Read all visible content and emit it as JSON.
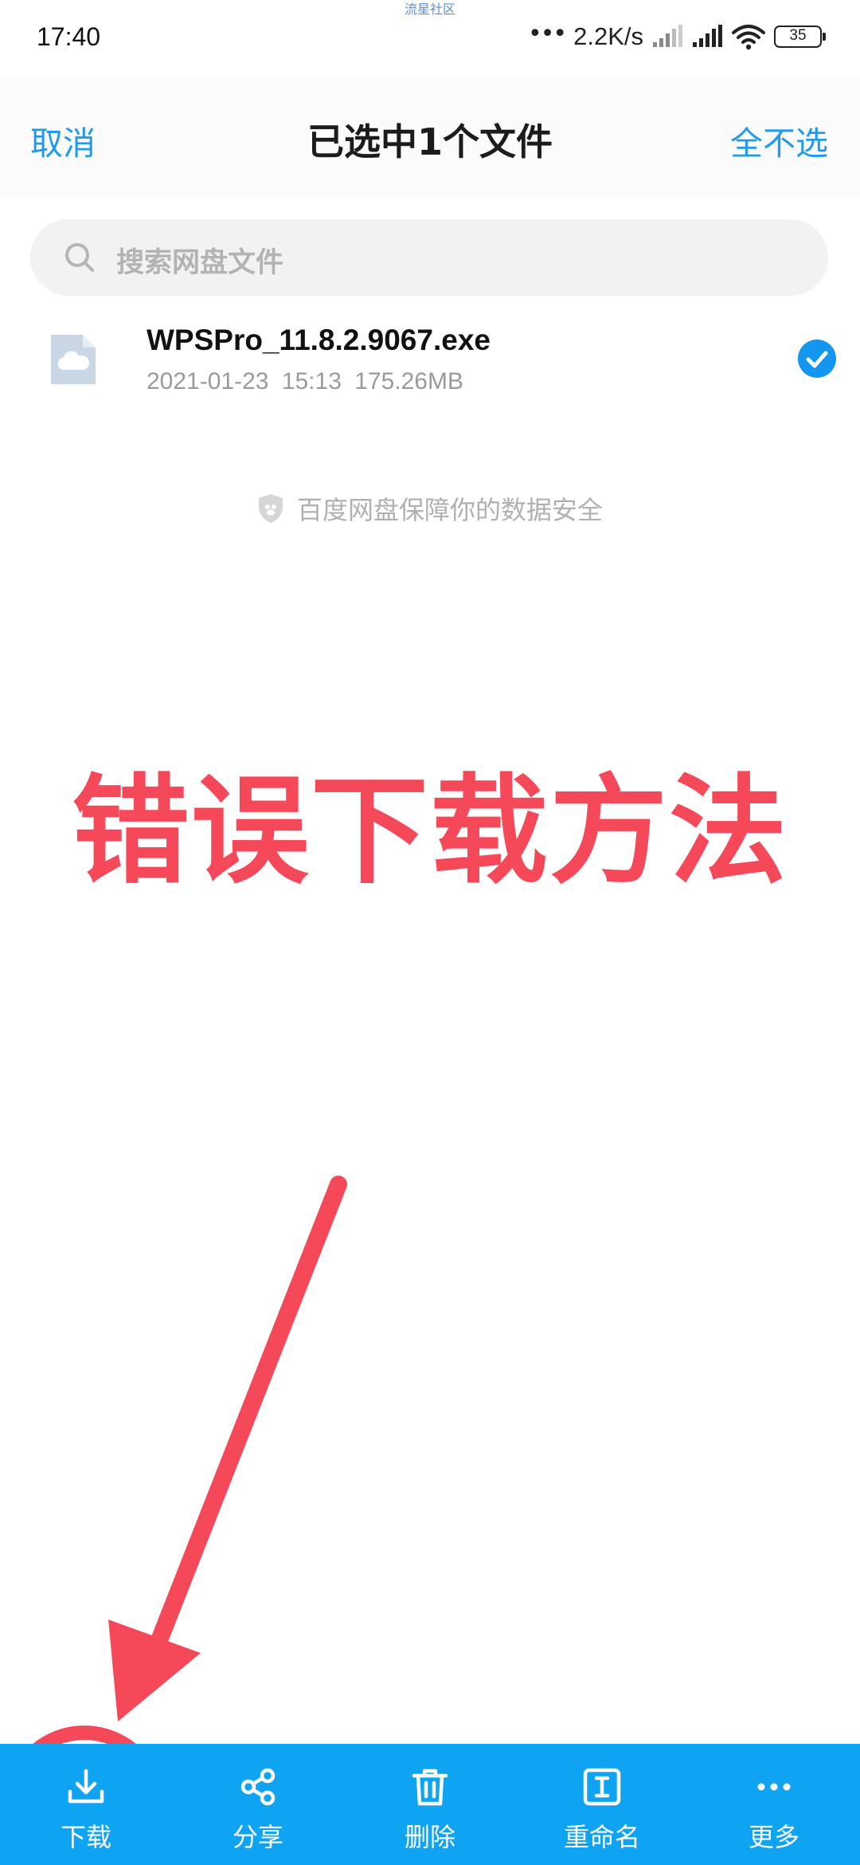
{
  "watermark": "流星社区",
  "status_bar": {
    "time": "17:40",
    "dots": "•••",
    "network_speed": "2.2K/s",
    "battery": "35"
  },
  "header": {
    "cancel_label": "取消",
    "title": "已选中1个文件",
    "deselect_all_label": "全不选"
  },
  "search": {
    "placeholder": "搜索网盘文件"
  },
  "files": [
    {
      "name": "WPSPro_11.8.2.9067.exe",
      "date": "2021-01-23",
      "time": "15:13",
      "size": "175.26MB",
      "selected": true
    }
  ],
  "security_note": "百度网盘保障你的数据安全",
  "overlay": {
    "caption": "错误下载方法"
  },
  "bottom_bar": {
    "items": [
      {
        "label": "下载",
        "icon": "download-icon"
      },
      {
        "label": "分享",
        "icon": "share-icon"
      },
      {
        "label": "删除",
        "icon": "trash-icon"
      },
      {
        "label": "重命名",
        "icon": "rename-icon"
      },
      {
        "label": "更多",
        "icon": "more-icon"
      }
    ]
  },
  "colors": {
    "accent": "#1f9be8",
    "bottom_bar": "#0fa4f2",
    "annotation_red": "#f5495a",
    "check_blue": "#1296ef"
  }
}
